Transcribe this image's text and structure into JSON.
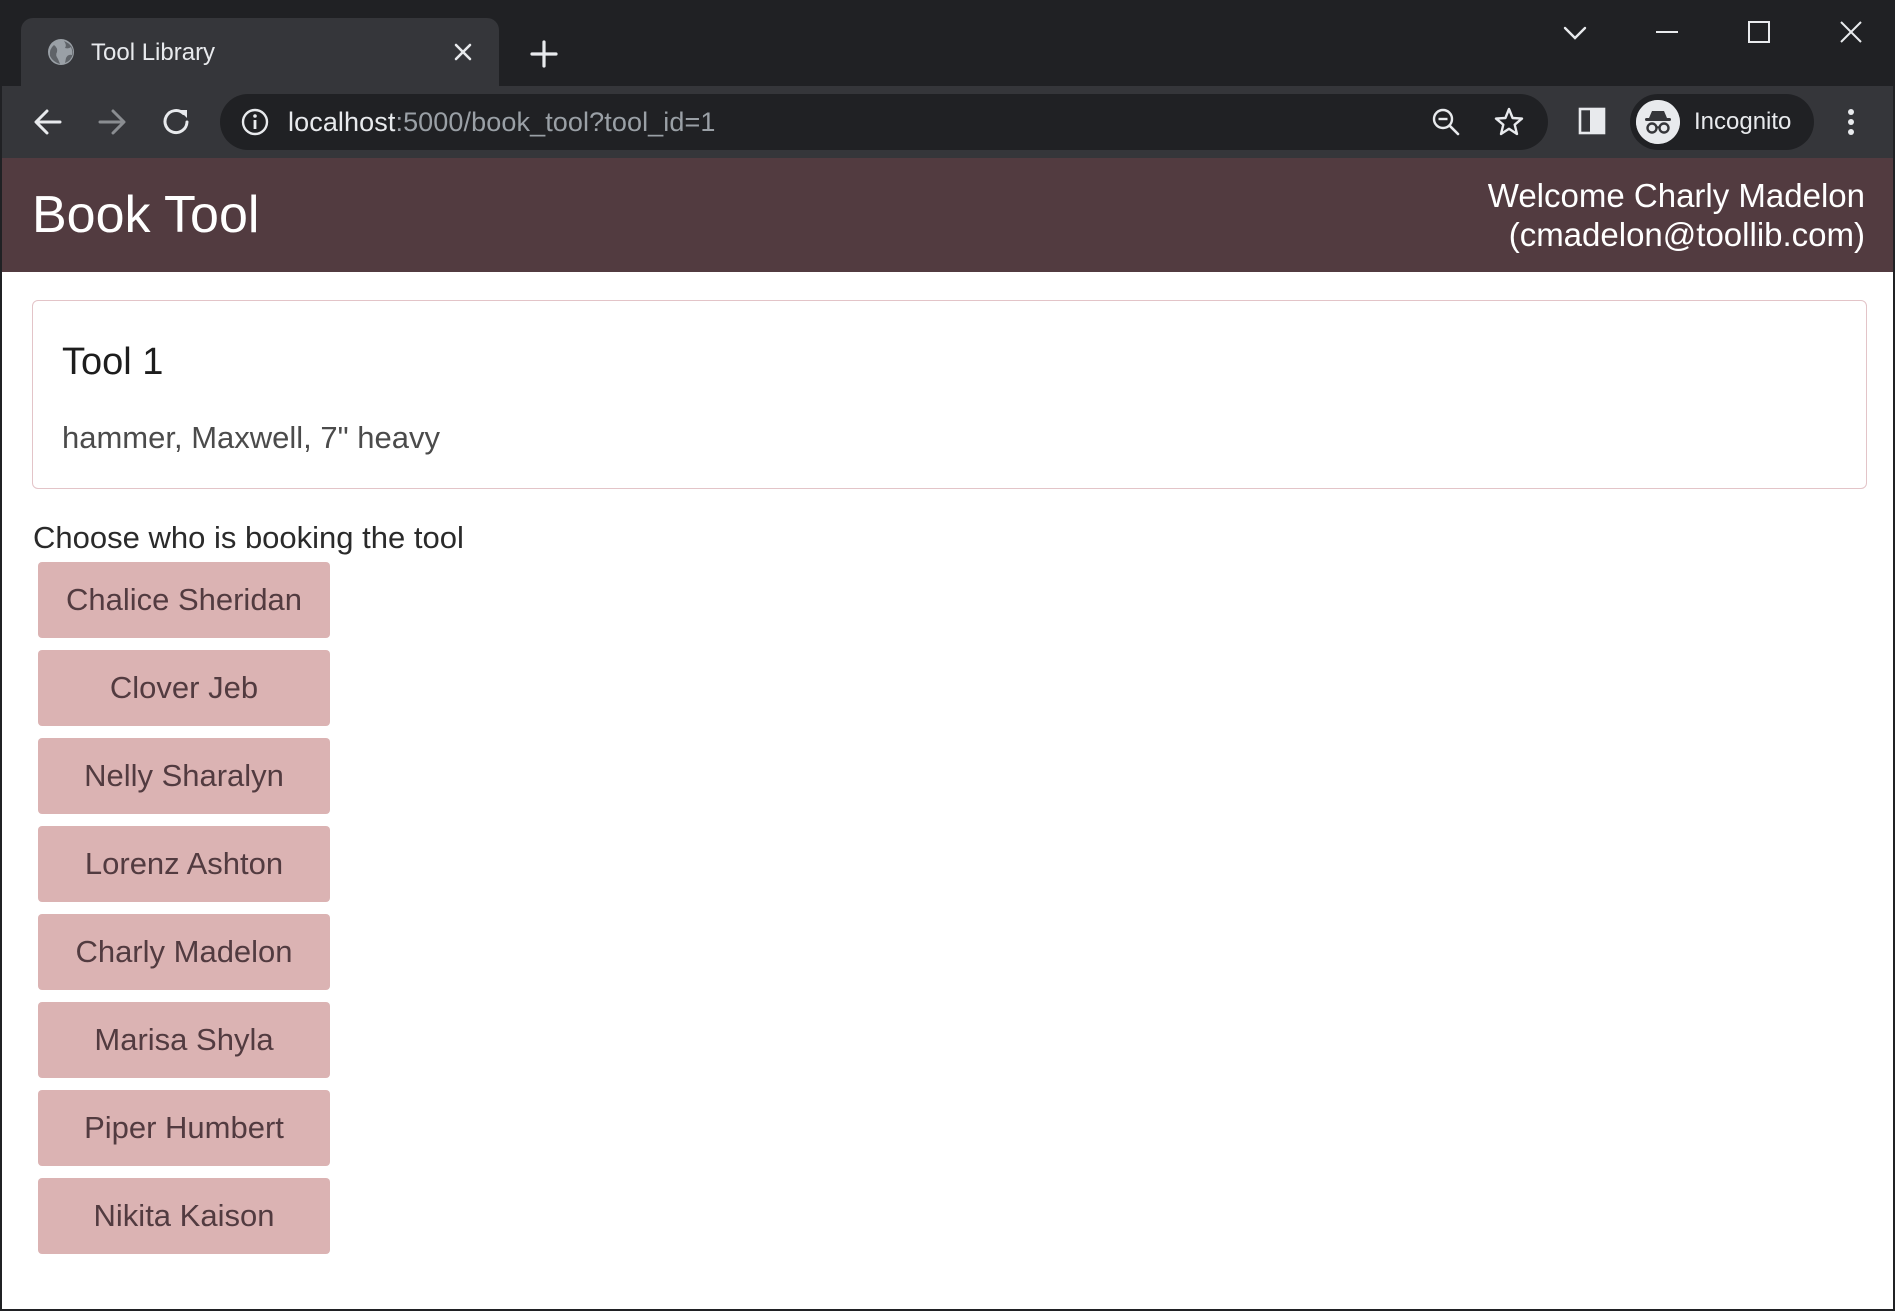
{
  "browser": {
    "tab_title": "Tool Library",
    "url_host": "localhost",
    "url_rest": ":5000/book_tool?tool_id=1",
    "profile_label": "Incognito"
  },
  "header": {
    "title": "Book Tool",
    "welcome_line1": "Welcome Charly Madelon",
    "welcome_line2": "(cmadelon@toollib.com)"
  },
  "tool": {
    "name": "Tool 1",
    "description": "hammer, Maxwell, 7\" heavy"
  },
  "booking": {
    "prompt": "Choose who is booking the tool",
    "members": [
      "Chalice Sheridan",
      "Clover Jeb",
      "Nelly Sharalyn",
      "Lorenz Ashton",
      "Charly Madelon",
      "Marisa Shyla",
      "Piper Humbert",
      "Nikita Kaison"
    ]
  },
  "colors": {
    "header_bg": "#523b40",
    "button_bg": "#dbb3b3",
    "button_text": "#523b40",
    "card_border": "#e3c4c8"
  },
  "icons": {
    "tab_favicon": "globe-icon",
    "tab_close": "close-icon",
    "new_tab": "plus-icon",
    "back": "back-arrow-icon",
    "forward": "forward-arrow-icon",
    "reload": "reload-icon",
    "site_info": "info-icon",
    "zoom": "zoom-out-icon",
    "bookmark": "star-icon",
    "side_panel": "side-panel-icon",
    "incognito": "incognito-icon",
    "menu": "kebab-menu-icon"
  }
}
